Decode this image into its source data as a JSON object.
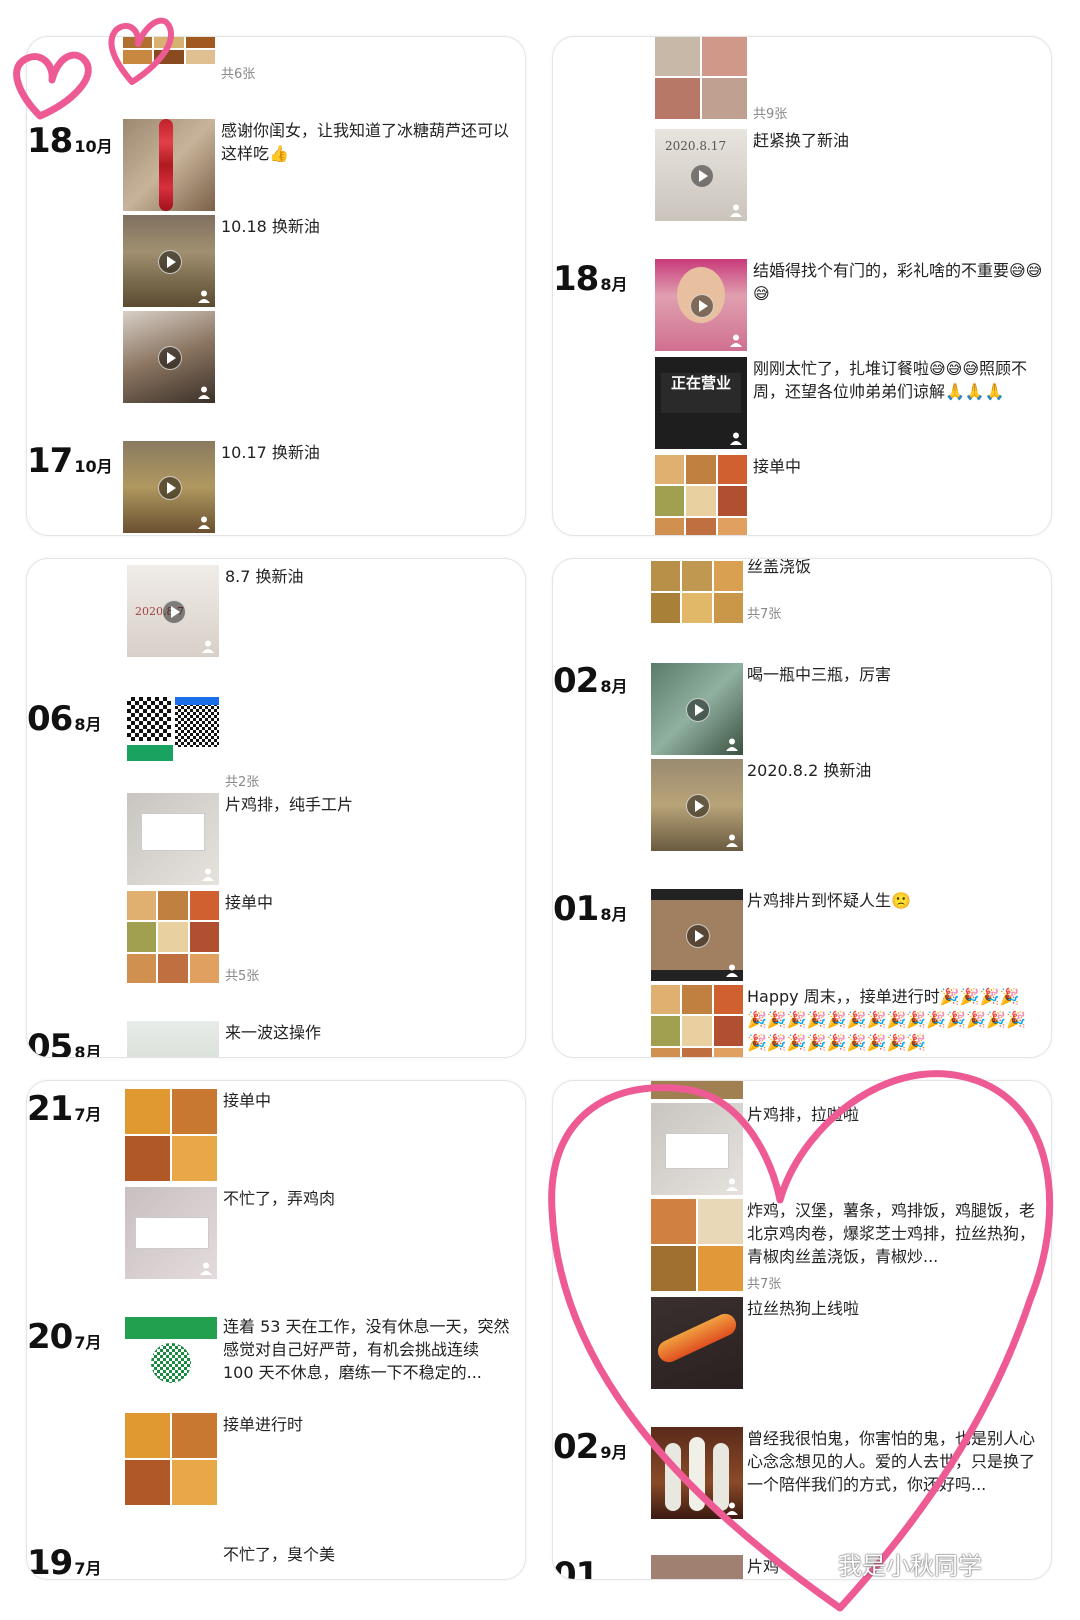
{
  "watermark": "我是小秋同学",
  "panel_tl": {
    "top_count": "共6张",
    "date1": {
      "day": "18",
      "month": "10月"
    },
    "post1": "感谢你闺女，让我知道了冰糖葫芦还可以这样吃👍",
    "post2": "10.18 换新油",
    "date2": {
      "day": "17",
      "month": "10月"
    },
    "post3": "10.17 换新油"
  },
  "panel_tr": {
    "count": "共9张",
    "post1": "赶紧换了新油",
    "date": {
      "day": "18",
      "month": "8月"
    },
    "post2": "结婚得找个有门的，彩礼啥的不重要😅😅😅",
    "post3": "刚刚太忙了，扎堆订餐啦😅😅😅照顾不周，还望各位帅弟弟们谅解🙏🙏🙏",
    "post4": "接单中"
  },
  "panel_ml": {
    "post1": "8.7 换新油",
    "date": {
      "day": "06",
      "month": "8月"
    },
    "count1": "共2张",
    "post2": "片鸡排，纯手工片",
    "post3": "接单中",
    "count2": "共5张",
    "cut_date": {
      "day": "05",
      "month": "8月"
    },
    "post4": "来一波这操作"
  },
  "panel_mr": {
    "top_text": "丝盖浇饭",
    "count": "共7张",
    "date1": {
      "day": "02",
      "month": "8月"
    },
    "post1": "喝一瓶中三瓶，厉害",
    "post2": "2020.8.2 换新油",
    "date2": {
      "day": "01",
      "month": "8月"
    },
    "post3": "片鸡排片到怀疑人生🙁",
    "post4": "Happy 周末，，接单进行时🎉🎉🎉🎉🎉🎉🎉🎉🎉🎉🎉🎉🎉🎉🎉🎉🎉🎉🎉🎉🎉🎉🎉🎉🎉🎉🎉"
  },
  "panel_bl": {
    "date1": {
      "day": "21",
      "month": "7月"
    },
    "post1": "接单中",
    "post2": "不忙了，弄鸡肉",
    "date2": {
      "day": "20",
      "month": "7月"
    },
    "post3": "连着 53 天在工作，没有休息一天，突然感觉对自己好严苛，有机会挑战连续 100 天不休息，磨练一下不稳定的...",
    "post4": "接单进行时",
    "date3": {
      "day": "19",
      "month": "7月"
    },
    "post5": "不忙了，臭个美"
  },
  "panel_br": {
    "post1": "片鸡排，拉啦啦",
    "post2": "炸鸡，汉堡，薯条，鸡排饭，鸡腿饭，老北京鸡肉卷，爆浆芝士鸡排，拉丝热狗，青椒肉丝盖浇饭，青椒炒...",
    "count": "共7张",
    "post3": "拉丝热狗上线啦",
    "date": {
      "day": "02",
      "month": "9月"
    },
    "post4": "曾经我很怕鬼，你害怕的鬼，也是别人心心念念想见的人。爱的人去世，只是换了一个陪伴我们的方式，你还好吗...",
    "post5": "片鸡"
  },
  "colors": {
    "heart": "#ee5a94",
    "text": "#222222",
    "muted": "#888888"
  }
}
